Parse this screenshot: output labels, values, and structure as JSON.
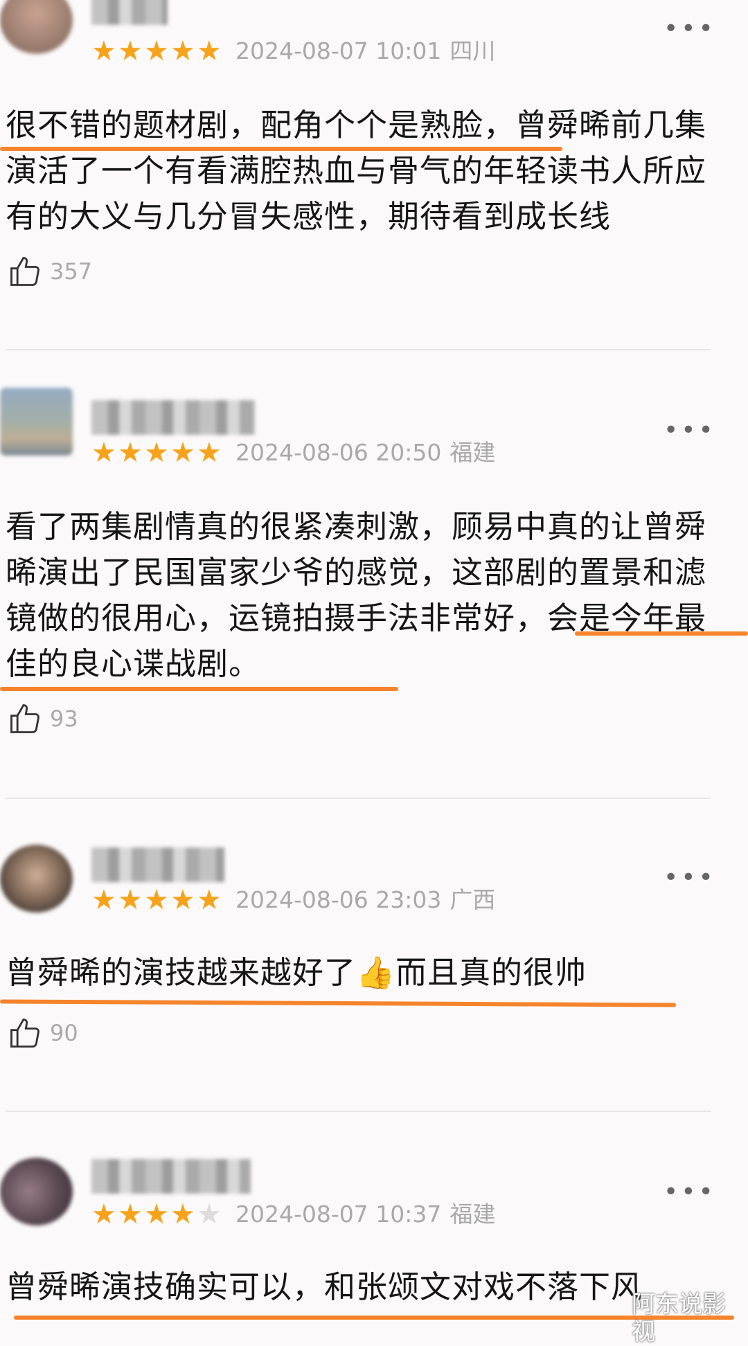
{
  "reviews": [
    {
      "stars": 5,
      "date": "2024-08-07 10:01",
      "location": "四川",
      "text": "很不错的题材剧，配角个个是熟脸，曾舜晞前几集演活了一个有看满腔热血与骨气的年轻读书人所应有的大义与几分冒失感性，期待看到成长线",
      "likes": "357",
      "avatar_color": "#b58d7a"
    },
    {
      "stars": 5,
      "date": "2024-08-06 20:50",
      "location": "福建",
      "text": "看了两集剧情真的很紧凑刺激，顾易中真的让曾舜晞演出了民国富家少爷的感觉，这部剧的置景和滤镜做的很用心，运镜拍摄手法非常好，会是今年最佳的良心谍战剧。",
      "likes": "93",
      "avatar_color": "#7d93a6"
    },
    {
      "stars": 5,
      "date": "2024-08-06 23:03",
      "location": "广西",
      "text": "曾舜晞的演技越来越好了👍而且真的很帅",
      "likes": "90",
      "avatar_color": "#6e5a4c"
    },
    {
      "stars": 4,
      "date": "2024-08-07 10:37",
      "location": "福建",
      "text": "曾舜晞演技确实可以，和张颂文对戏不落下风",
      "avatar_color": "#5a4550"
    }
  ],
  "more_glyph": "•••",
  "watermark": "阿东说影视",
  "colors": {
    "star": "#f6a31b",
    "underline": "#f5842c",
    "meta": "#a9a9a9"
  }
}
